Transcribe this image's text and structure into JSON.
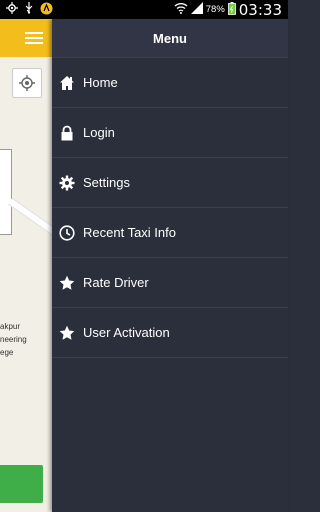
{
  "status_bar": {
    "battery_percent": "78%",
    "time": "03:33"
  },
  "drawer": {
    "title": "Menu",
    "items": [
      {
        "label": "Home",
        "icon": "home-icon"
      },
      {
        "label": "Login",
        "icon": "lock-icon"
      },
      {
        "label": "Settings",
        "icon": "gear-icon"
      },
      {
        "label": "Recent Taxi Info",
        "icon": "clock-icon"
      },
      {
        "label": "Rate Driver",
        "icon": "star-icon"
      },
      {
        "label": "User Activation",
        "icon": "star-icon"
      }
    ]
  },
  "map": {
    "label_lines": [
      "akpur",
      "neering",
      "ege"
    ]
  },
  "colors": {
    "accent": "#f3be1c",
    "drawer_bg": "#2b2e3b",
    "green": "#3fae49"
  }
}
